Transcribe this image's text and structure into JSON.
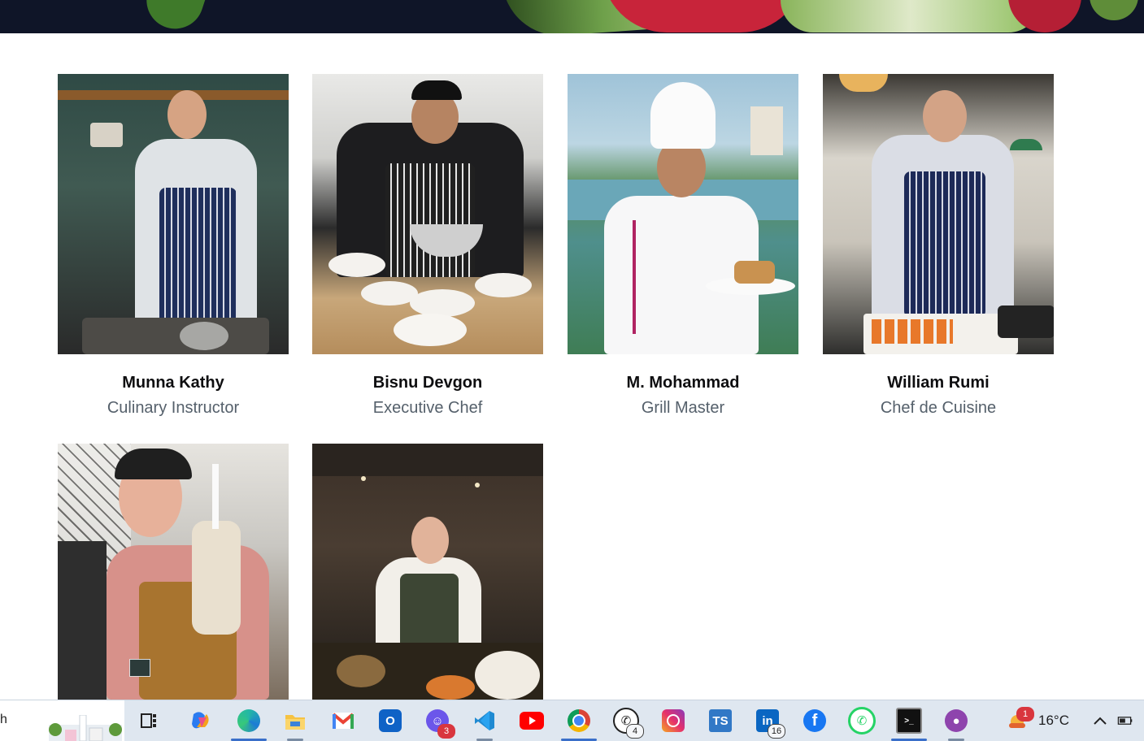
{
  "team": [
    {
      "name": "Munna Kathy",
      "role": "Culinary Instructor"
    },
    {
      "name": "Bisnu Devgon",
      "role": "Executive Chef"
    },
    {
      "name": "M. Mohammad",
      "role": "Grill Master"
    },
    {
      "name": "William Rumi",
      "role": "Chef de Cuisine"
    },
    {
      "name": "",
      "role": ""
    },
    {
      "name": "",
      "role": ""
    }
  ],
  "taskbar": {
    "search_text": "h",
    "apps": [
      {
        "name": "task-view-icon",
        "badge": ""
      },
      {
        "name": "copilot-icon",
        "badge": ""
      },
      {
        "name": "edge-icon",
        "badge": ""
      },
      {
        "name": "file-explorer-icon",
        "badge": ""
      },
      {
        "name": "gmail-icon",
        "badge": ""
      },
      {
        "name": "outlook-icon",
        "badge": ""
      },
      {
        "name": "discord-icon",
        "badge": "3"
      },
      {
        "name": "vscode-icon",
        "badge": ""
      },
      {
        "name": "youtube-icon",
        "badge": ""
      },
      {
        "name": "chrome-icon",
        "badge": ""
      },
      {
        "name": "whatsapp-icon",
        "badge": "4"
      },
      {
        "name": "instagram-icon",
        "badge": ""
      },
      {
        "name": "typescript-icon",
        "badge": ""
      },
      {
        "name": "linkedin-icon",
        "badge": "16"
      },
      {
        "name": "facebook-icon",
        "badge": ""
      },
      {
        "name": "whatsapp-web-icon",
        "badge": ""
      },
      {
        "name": "terminal-icon",
        "badge": ""
      },
      {
        "name": "github-icon",
        "badge": ""
      }
    ],
    "weather_badge": "1",
    "temperature": "16°C",
    "ts_label": "TS",
    "linkedin_label": "in"
  }
}
